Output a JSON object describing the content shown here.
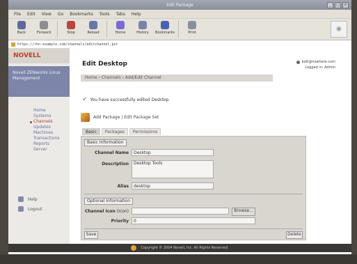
{
  "window": {
    "title": "Edit Package"
  },
  "menubar": {
    "items": [
      "File",
      "Edit",
      "View",
      "Go",
      "Bookmarks",
      "Tools",
      "Tabs",
      "Help"
    ]
  },
  "toolbar": {
    "buttons": [
      {
        "label": "Back",
        "icon": "back-arrow-icon",
        "color": "#5c6b9a"
      },
      {
        "label": "Forward",
        "icon": "forward-arrow-icon",
        "color": "#8e8e8e"
      },
      {
        "label": "Stop",
        "icon": "stop-icon",
        "color": "#b9473a"
      },
      {
        "label": "Reload",
        "icon": "reload-icon",
        "color": "#6877a8"
      },
      {
        "label": "Home",
        "icon": "home-icon",
        "color": "#7c6ad0"
      },
      {
        "label": "History",
        "icon": "history-icon",
        "color": "#7b83a8"
      },
      {
        "label": "Bookmarks",
        "icon": "bookmarks-icon",
        "color": "#4b5fb3"
      },
      {
        "label": "Print",
        "icon": "print-icon",
        "color": "#8a8fa0"
      }
    ]
  },
  "urlbar": {
    "value": "https://rhn.example.com/channels/editchannel.pxt"
  },
  "sidebar": {
    "logo": "NOVELL",
    "banner": "Novell ZENworks Linux Management",
    "items": [
      {
        "label": "Home",
        "active": false
      },
      {
        "label": "Systems",
        "active": false
      },
      {
        "label": "Channels",
        "active": true
      },
      {
        "label": "Updates",
        "active": false
      },
      {
        "label": "Machines",
        "active": false
      },
      {
        "label": "Transactions",
        "active": false
      },
      {
        "label": "Reports",
        "active": false
      },
      {
        "label": "Server",
        "active": false
      }
    ],
    "tools": [
      {
        "label": "Help",
        "icon": "help-icon"
      },
      {
        "label": "Logout",
        "icon": "logout-icon"
      }
    ]
  },
  "header": {
    "title": "Edit Desktop",
    "breadcrumb": "Home › Channels › Add/Edit Channel",
    "user": "bolt@nowhere.com",
    "login_info": "Logged in: Admin"
  },
  "messages": {
    "success": "You have successfully edited Desktop."
  },
  "package_actions": {
    "text": "Add Package | Edit Package Set"
  },
  "tabs": [
    {
      "label": "Basic",
      "active": true
    },
    {
      "label": "Packages",
      "active": false
    },
    {
      "label": "Permissions",
      "active": false
    }
  ],
  "form": {
    "basic_section": "Basic Information",
    "channel_name_label": "Channel Name",
    "channel_name_value": "Desktop",
    "description_label": "Description",
    "description_value": "Desktop Tools",
    "alias_label": "Alias",
    "alias_value": "desktop",
    "optional_section": "Optional Information",
    "channel_icon_label": "Channel Icon",
    "channel_icon_hint": "(Icon)",
    "browse_label": "Browse...",
    "priority_label": "Priority",
    "priority_value": "0",
    "save_label": "Save",
    "delete_label": "Delete"
  },
  "footer": {
    "text": "Copyright © 2004 Novell, Inc. All Rights Reserved."
  }
}
